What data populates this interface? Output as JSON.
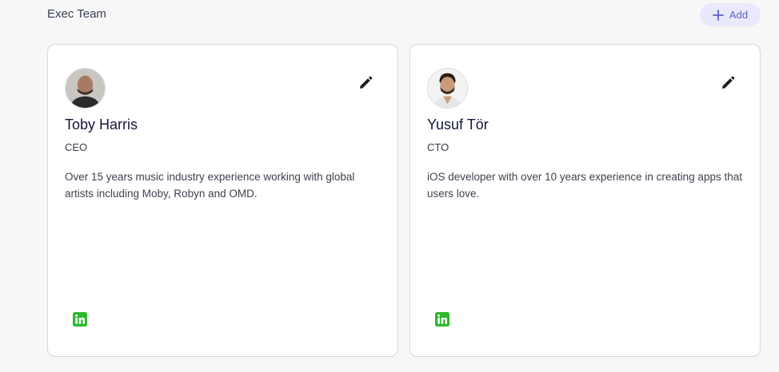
{
  "header": {
    "title": "Exec Team",
    "add_label": "Add"
  },
  "members": [
    {
      "name": "Toby Harris",
      "role": "CEO",
      "bio": "Over 15 years music industry experience working with global artists including Moby, Robyn and OMD."
    },
    {
      "name": "Yusuf Tör",
      "role": "CTO",
      "bio": "iOS developer with over 10 years experience in creating apps that users love."
    }
  ],
  "icons": {
    "add": "plus-icon",
    "edit": "pencil-icon",
    "social": "linkedin-icon"
  },
  "colors": {
    "accent": "#5b5fc7",
    "accent_bg": "#e9e9fb",
    "linkedin": "#2db82d"
  }
}
